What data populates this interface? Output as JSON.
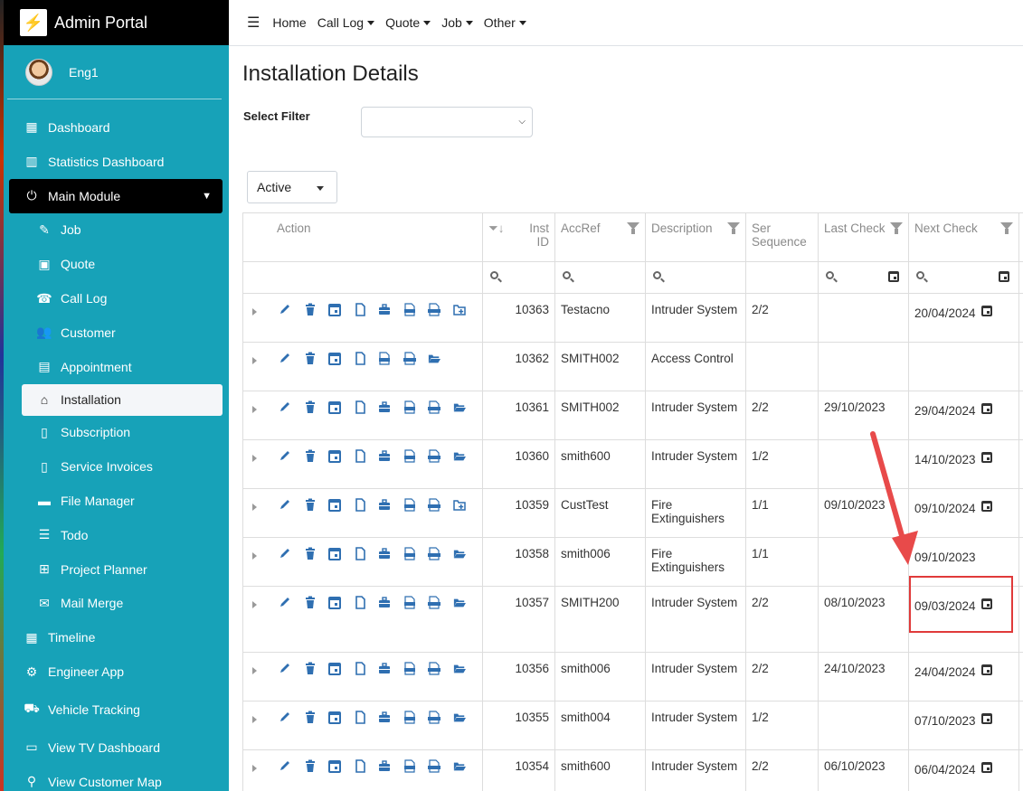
{
  "app": {
    "title": "Admin Portal",
    "logo_glyph": "⚡"
  },
  "user": {
    "name": "Eng1"
  },
  "sidebar": {
    "items": [
      {
        "label": "Dashboard",
        "icon": "grid-icon",
        "glyph": "▦"
      },
      {
        "label": "Statistics Dashboard",
        "icon": "chart-icon",
        "glyph": "▥"
      },
      {
        "label": "Main Module",
        "icon": "plug-icon",
        "glyph": "⏻"
      },
      {
        "label": "Job",
        "icon": "wrench-icon",
        "glyph": "✎"
      },
      {
        "label": "Quote",
        "icon": "calculator-icon",
        "glyph": "▣"
      },
      {
        "label": "Call Log",
        "icon": "user-phone-icon",
        "glyph": "☎"
      },
      {
        "label": "Customer",
        "icon": "users-icon",
        "glyph": "👥"
      },
      {
        "label": "Appointment",
        "icon": "calendar-check-icon",
        "glyph": "▤"
      },
      {
        "label": "Installation",
        "icon": "home-icon",
        "glyph": "⌂"
      },
      {
        "label": "Subscription",
        "icon": "file-icon",
        "glyph": "▯"
      },
      {
        "label": "Service Invoices",
        "icon": "invoice-icon",
        "glyph": "▯"
      },
      {
        "label": "File Manager",
        "icon": "folder-icon",
        "glyph": "▬"
      },
      {
        "label": "Todo",
        "icon": "list-check-icon",
        "glyph": "☰"
      },
      {
        "label": "Project Planner",
        "icon": "sitemap-icon",
        "glyph": "⊞"
      },
      {
        "label": "Mail Merge",
        "icon": "mail-merge-icon",
        "glyph": "✉"
      },
      {
        "label": "Timeline",
        "icon": "calendar-icon",
        "glyph": "▦"
      },
      {
        "label": "Engineer App",
        "icon": "user-gear-icon",
        "glyph": "⚙"
      },
      {
        "label": "Vehicle Tracking",
        "icon": "vehicle-icon",
        "glyph": "⛟"
      },
      {
        "label": "View TV Dashboard",
        "icon": "tv-icon",
        "glyph": "▭"
      },
      {
        "label": "View Customer Map",
        "icon": "map-user-icon",
        "glyph": "⚲"
      }
    ]
  },
  "topnav": {
    "items": [
      "Home",
      "Call Log",
      "Quote",
      "Job",
      "Other"
    ]
  },
  "page": {
    "title": "Installation Details",
    "filter_label": "Select Filter",
    "filter_value": "",
    "status_value": "Active"
  },
  "table": {
    "columns": [
      "Action",
      "Inst ID",
      "AccRef",
      "Description",
      "Ser Sequence",
      "Last Check",
      "Next Check"
    ],
    "rows": [
      {
        "id": "10363",
        "acc": "Testacno",
        "desc": "Intruder System",
        "seq": "2/2",
        "last": "",
        "next": "20/04/2024",
        "next_cal": true,
        "folder": "plus"
      },
      {
        "id": "10362",
        "acc": "SMITH002",
        "desc": "Access Control",
        "seq": "",
        "last": "",
        "next": "",
        "next_cal": false,
        "folder": "open",
        "no_box": true
      },
      {
        "id": "10361",
        "acc": "SMITH002",
        "desc": "Intruder System",
        "seq": "2/2",
        "last": "29/10/2023",
        "next": "29/04/2024",
        "next_cal": true,
        "folder": "open"
      },
      {
        "id": "10360",
        "acc": "smith600",
        "desc": "Intruder System",
        "seq": "1/2",
        "last": "",
        "next": "14/10/2023",
        "next_cal": true,
        "folder": "open"
      },
      {
        "id": "10359",
        "acc": "CustTest",
        "desc": "Fire Extinguishers",
        "seq": "1/1",
        "last": "09/10/2023",
        "next": "09/10/2024",
        "next_cal": true,
        "folder": "plus"
      },
      {
        "id": "10358",
        "acc": "smith006",
        "desc": "Fire Extinguishers",
        "seq": "1/1",
        "last": "",
        "next": "09/10/2023",
        "next_cal": false,
        "folder": "open"
      },
      {
        "id": "10357",
        "acc": "SMITH200",
        "desc": "Intruder System",
        "seq": "2/2",
        "last": "08/10/2023",
        "next": "09/03/2024",
        "next_cal": true,
        "folder": "open",
        "tall": true
      },
      {
        "id": "10356",
        "acc": "smith006",
        "desc": "Intruder System",
        "seq": "2/2",
        "last": "24/10/2023",
        "next": "24/04/2024",
        "next_cal": true,
        "folder": "open"
      },
      {
        "id": "10355",
        "acc": "smith004",
        "desc": "Intruder System",
        "seq": "1/2",
        "last": "",
        "next": "07/10/2023",
        "next_cal": true,
        "folder": "open"
      },
      {
        "id": "10354",
        "acc": "smith600",
        "desc": "Intruder System",
        "seq": "2/2",
        "last": "06/10/2023",
        "next": "06/04/2024",
        "next_cal": true,
        "folder": "open"
      }
    ]
  },
  "colors": {
    "sidebar": "#17a2b8",
    "accent_icon": "#2f6fb1",
    "highlight": "#e03a3a"
  }
}
